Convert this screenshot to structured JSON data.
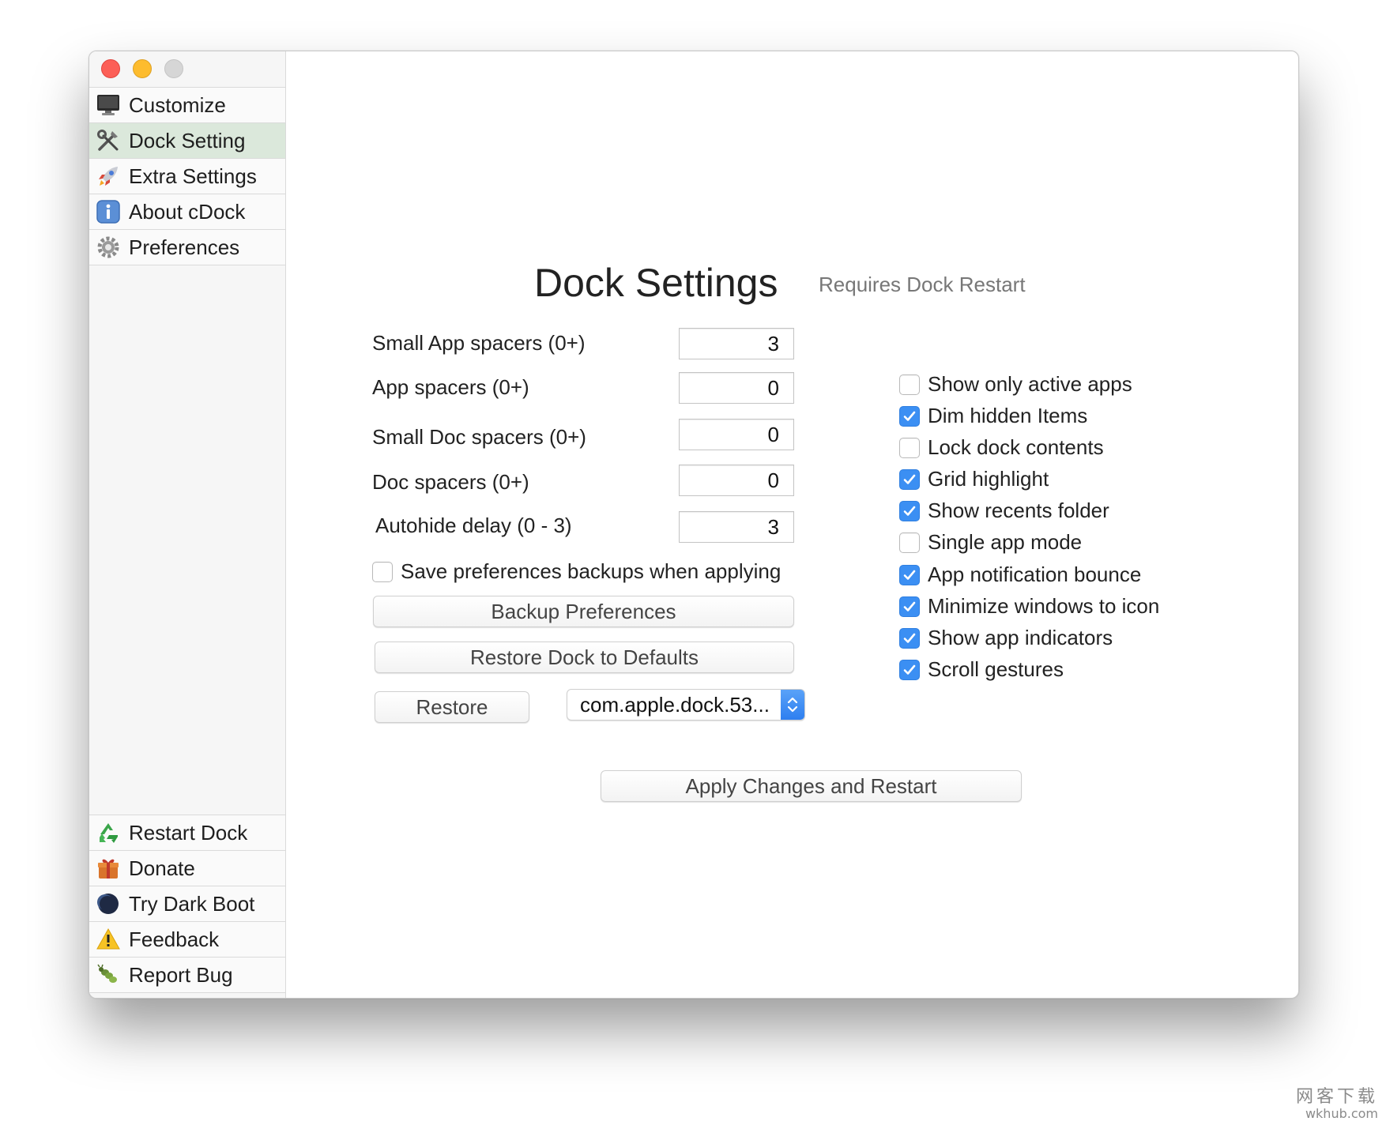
{
  "sidebar": {
    "top_items": [
      {
        "label": "Customize",
        "icon": "monitor-icon"
      },
      {
        "label": "Dock Setting",
        "icon": "tools-icon",
        "active": true
      },
      {
        "label": "Extra Settings",
        "icon": "rocket-icon"
      },
      {
        "label": "About cDock",
        "icon": "info-icon"
      },
      {
        "label": "Preferences",
        "icon": "gear-icon"
      }
    ],
    "bottom_items": [
      {
        "label": "Restart Dock",
        "icon": "recycle-icon"
      },
      {
        "label": "Donate",
        "icon": "gift-icon"
      },
      {
        "label": "Try Dark Boot",
        "icon": "moon-icon"
      },
      {
        "label": "Feedback",
        "icon": "warning-icon"
      },
      {
        "label": "Report Bug",
        "icon": "bug-icon"
      }
    ]
  },
  "main": {
    "title": "Dock Settings",
    "subtitle": "Requires Dock Restart",
    "fields": [
      {
        "label": "Small App spacers (0+)",
        "value": "3"
      },
      {
        "label": "App spacers (0+)",
        "value": "0"
      },
      {
        "label": "Small Doc spacers (0+)",
        "value": "0"
      },
      {
        "label": "Doc spacers (0+)",
        "value": "0"
      },
      {
        "label": "Autohide delay (0 - 3)",
        "value": "3"
      }
    ],
    "save_backups": {
      "label": "Save preferences backups when applying",
      "checked": false
    },
    "backup_button": "Backup Preferences",
    "restore_defaults_button": "Restore Dock to Defaults",
    "restore_button": "Restore",
    "restore_select": "com.apple.dock.53...",
    "apply_button": "Apply Changes and Restart",
    "options": [
      {
        "label": "Show only active apps",
        "checked": false
      },
      {
        "label": "Dim hidden Items",
        "checked": true
      },
      {
        "label": "Lock dock contents",
        "checked": false
      },
      {
        "label": "Grid highlight",
        "checked": true
      },
      {
        "label": "Show recents folder",
        "checked": true
      },
      {
        "label": "Single app mode",
        "checked": false
      },
      {
        "label": "App notification bounce",
        "checked": true
      },
      {
        "label": "Minimize windows to icon",
        "checked": true
      },
      {
        "label": "Show app indicators",
        "checked": true
      },
      {
        "label": "Scroll gestures",
        "checked": true
      }
    ]
  },
  "watermark": {
    "line1": "网客下载",
    "line2": "wkhub.com"
  },
  "colors": {
    "accent": "#3b8ff3",
    "active_item": "#dbe8db"
  }
}
